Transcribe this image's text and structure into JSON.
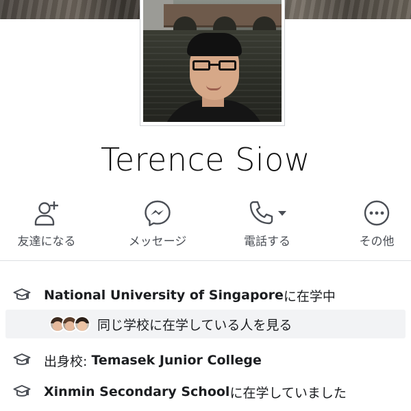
{
  "profile": {
    "name": "Terence Siow"
  },
  "actions": [
    {
      "label": "友達になる",
      "icon": "add-friend-icon"
    },
    {
      "label": "メッセージ",
      "icon": "messenger-icon"
    },
    {
      "label": "電話する",
      "icon": "phone-icon"
    },
    {
      "label": "その他",
      "icon": "more-icon"
    }
  ],
  "education": {
    "current": {
      "school": "National University of Singapore",
      "suffix": "に在学中"
    },
    "classmates_link": "同じ学校に在学している人を見る",
    "alma_mater": {
      "prefix": "出身校: ",
      "school": "Temasek Junior College"
    },
    "past": {
      "school": "Xinmin Secondary School",
      "suffix": "に在学していました"
    }
  },
  "colors": {
    "icon": "#4b4f56",
    "text": "#1c1e21",
    "link_bg": "#f2f3f5",
    "divider": "#dddfe2"
  }
}
